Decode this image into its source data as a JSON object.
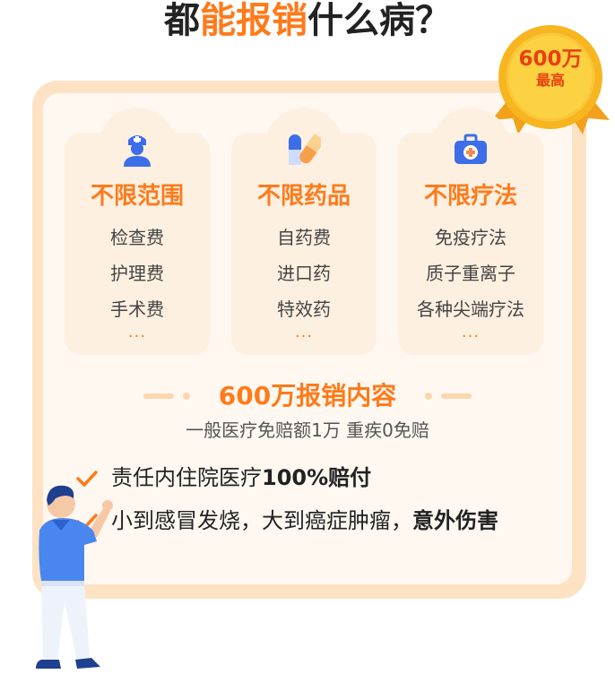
{
  "title": {
    "part1": "都",
    "highlight": "能报销",
    "part2": "什么病？"
  },
  "badge": {
    "amount": "600万",
    "label": "最高"
  },
  "cards": [
    {
      "icon": "nurse-icon",
      "title": "不限范围",
      "items": [
        "检查费",
        "护理费",
        "手术费"
      ],
      "more": "..."
    },
    {
      "icon": "pill-icon",
      "title": "不限药品",
      "items": [
        "自药费",
        "进口药",
        "特效药"
      ],
      "more": "..."
    },
    {
      "icon": "medical-kit-icon",
      "title": "不限疗法",
      "items": [
        "免疫疗法",
        "质子重离子",
        "各种尖端疗法"
      ],
      "more": "..."
    }
  ],
  "coverage": {
    "title": "600万报销内容",
    "desc": "一般医疗免赔额1万 重疾0免赔"
  },
  "bullets": [
    {
      "normal": "责任内住院医疗",
      "strong": "100%赔付"
    },
    {
      "normal": "小到感冒发烧，大到癌症肿瘤，",
      "strong": "意外伤害"
    }
  ],
  "colors": {
    "accent": "#ff7a1a",
    "panel": "#fde3c4",
    "badge": "#f7b51f",
    "icon_blue": "#3b6ee8"
  }
}
